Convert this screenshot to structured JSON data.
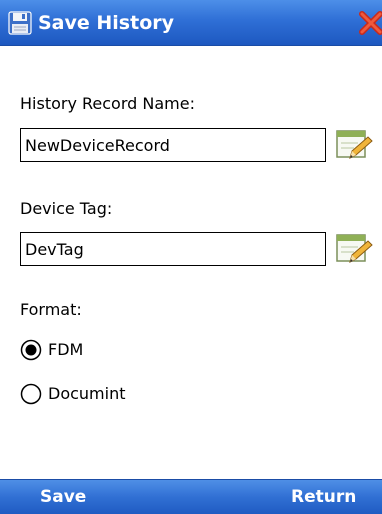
{
  "window": {
    "title": "Save History",
    "title_icon": "floppy-disk-icon",
    "close_icon": "close-x-icon"
  },
  "form": {
    "record_name_label": "History Record Name:",
    "record_name_value": "NewDeviceRecord",
    "device_tag_label": "Device Tag:",
    "device_tag_value": "DevTag",
    "edit_icon": "edit-pencil-icon",
    "format_label": "Format:",
    "format_options": [
      {
        "label": "FDM",
        "selected": true
      },
      {
        "label": "Documint",
        "selected": false
      }
    ]
  },
  "softkeys": {
    "left": "Save",
    "right": "Return"
  },
  "colors": {
    "title_bar": "#2f6fd6",
    "close_red": "#e0392a",
    "text": "#000000"
  }
}
